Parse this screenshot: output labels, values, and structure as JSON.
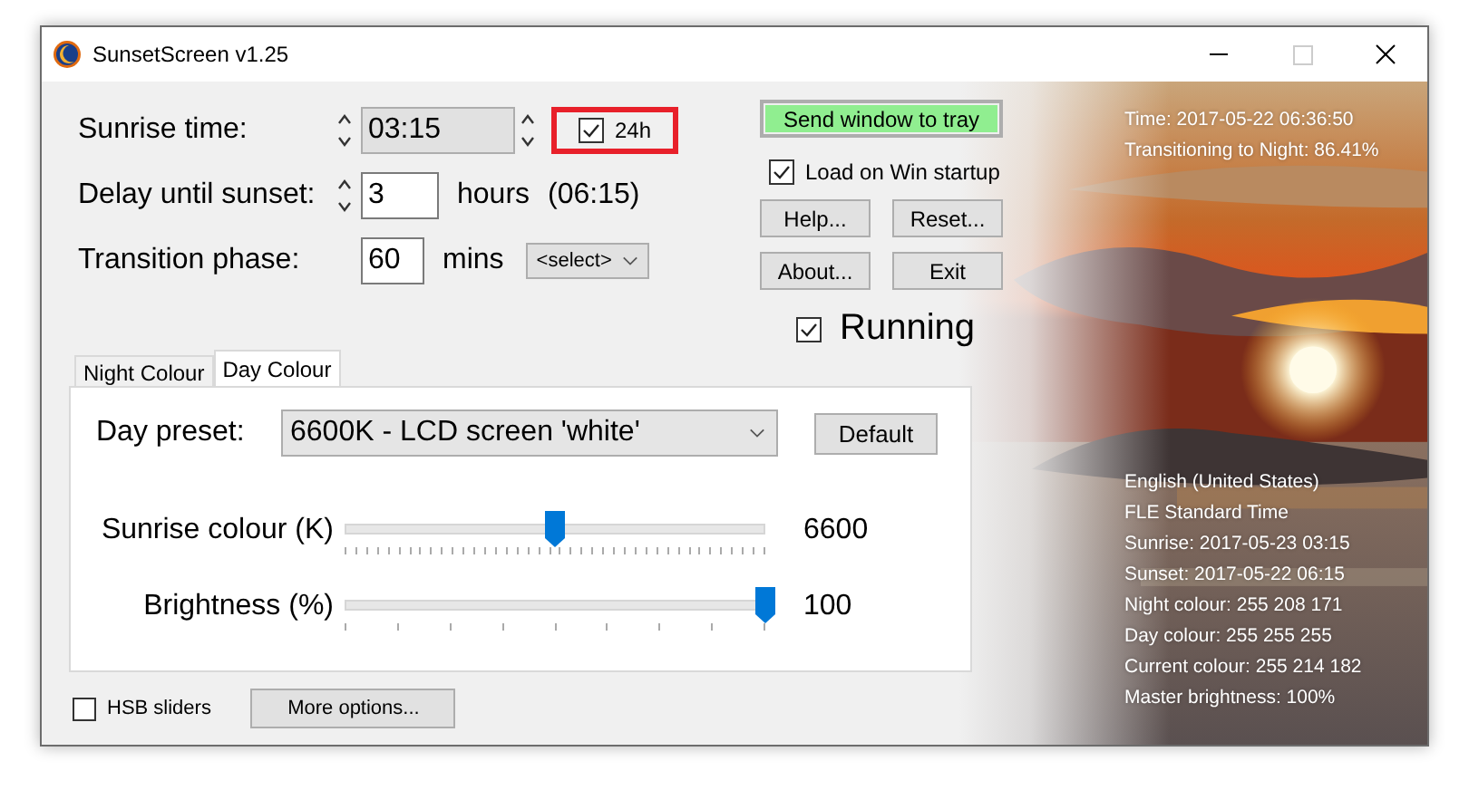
{
  "window": {
    "title": "SunsetScreen v1.25"
  },
  "settings": [
    {
      "label": "Sunrise time:",
      "value": "03:15",
      "kind": "time",
      "disabled": true
    },
    {
      "label": "Delay until sunset:",
      "value": "3",
      "kind": "hours",
      "unit": "hours",
      "extra": "(06:15)"
    },
    {
      "label": "Transition phase:",
      "value": "60",
      "kind": "mins",
      "unit": "mins",
      "dropdown": "<select>"
    }
  ],
  "clock_24h": {
    "label": "24h",
    "checked": true,
    "highlighted": true
  },
  "tray_button": "Send window to tray",
  "load_on_startup": {
    "label": "Load on Win startup",
    "checked": true
  },
  "buttons": [
    "Help...",
    "Reset...",
    "About...",
    "Exit"
  ],
  "running": {
    "label": "Running",
    "checked": true
  },
  "tabs": [
    {
      "label": "Night Colour",
      "selected": false
    },
    {
      "label": "Day Colour",
      "selected": true
    }
  ],
  "preset": {
    "label": "Day preset:",
    "value": "6600K - LCD screen 'white'",
    "button": "Default"
  },
  "sliders": [
    {
      "label": "Sunrise colour (K)",
      "level": 0.5,
      "reading": "6600",
      "kind": "fine"
    },
    {
      "label": "Brightness (%)",
      "level": 1.0,
      "reading": "100",
      "kind": "coarse"
    }
  ],
  "hsb_sliders": {
    "label": "HSB sliders",
    "checked": false
  },
  "more_options": "More options...",
  "status_top": [
    "Time: 2017-05-22 06:36:50",
    "Transitioning to Night: 86.41%"
  ],
  "status_bottom": [
    "English (United States)",
    "FLE Standard Time",
    "Sunrise: 2017-05-23 03:15",
    "Sunset: 2017-05-22 06:15",
    "Night colour: 255 208 171",
    "Day colour: 255 255 255",
    "Current colour: 255 214 182",
    "Master brightness: 100%"
  ]
}
